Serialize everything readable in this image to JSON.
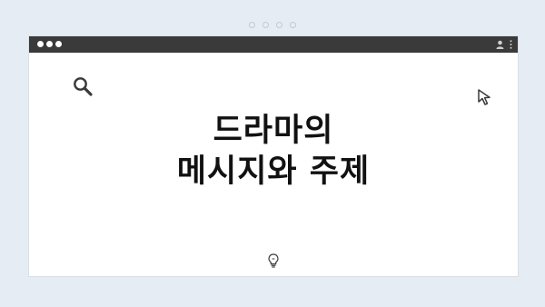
{
  "slide": {
    "title_line1": "드라마의",
    "title_line2": "메시지와 주제"
  },
  "icons": {
    "search": "search-icon",
    "cursor": "cursor-icon",
    "user": "user-icon",
    "menu": "kebab-menu-icon",
    "idea": "lightbulb-icon"
  },
  "colors": {
    "titlebar": "#3a3a3a",
    "background": "#e6ecf3",
    "text": "#111111"
  }
}
